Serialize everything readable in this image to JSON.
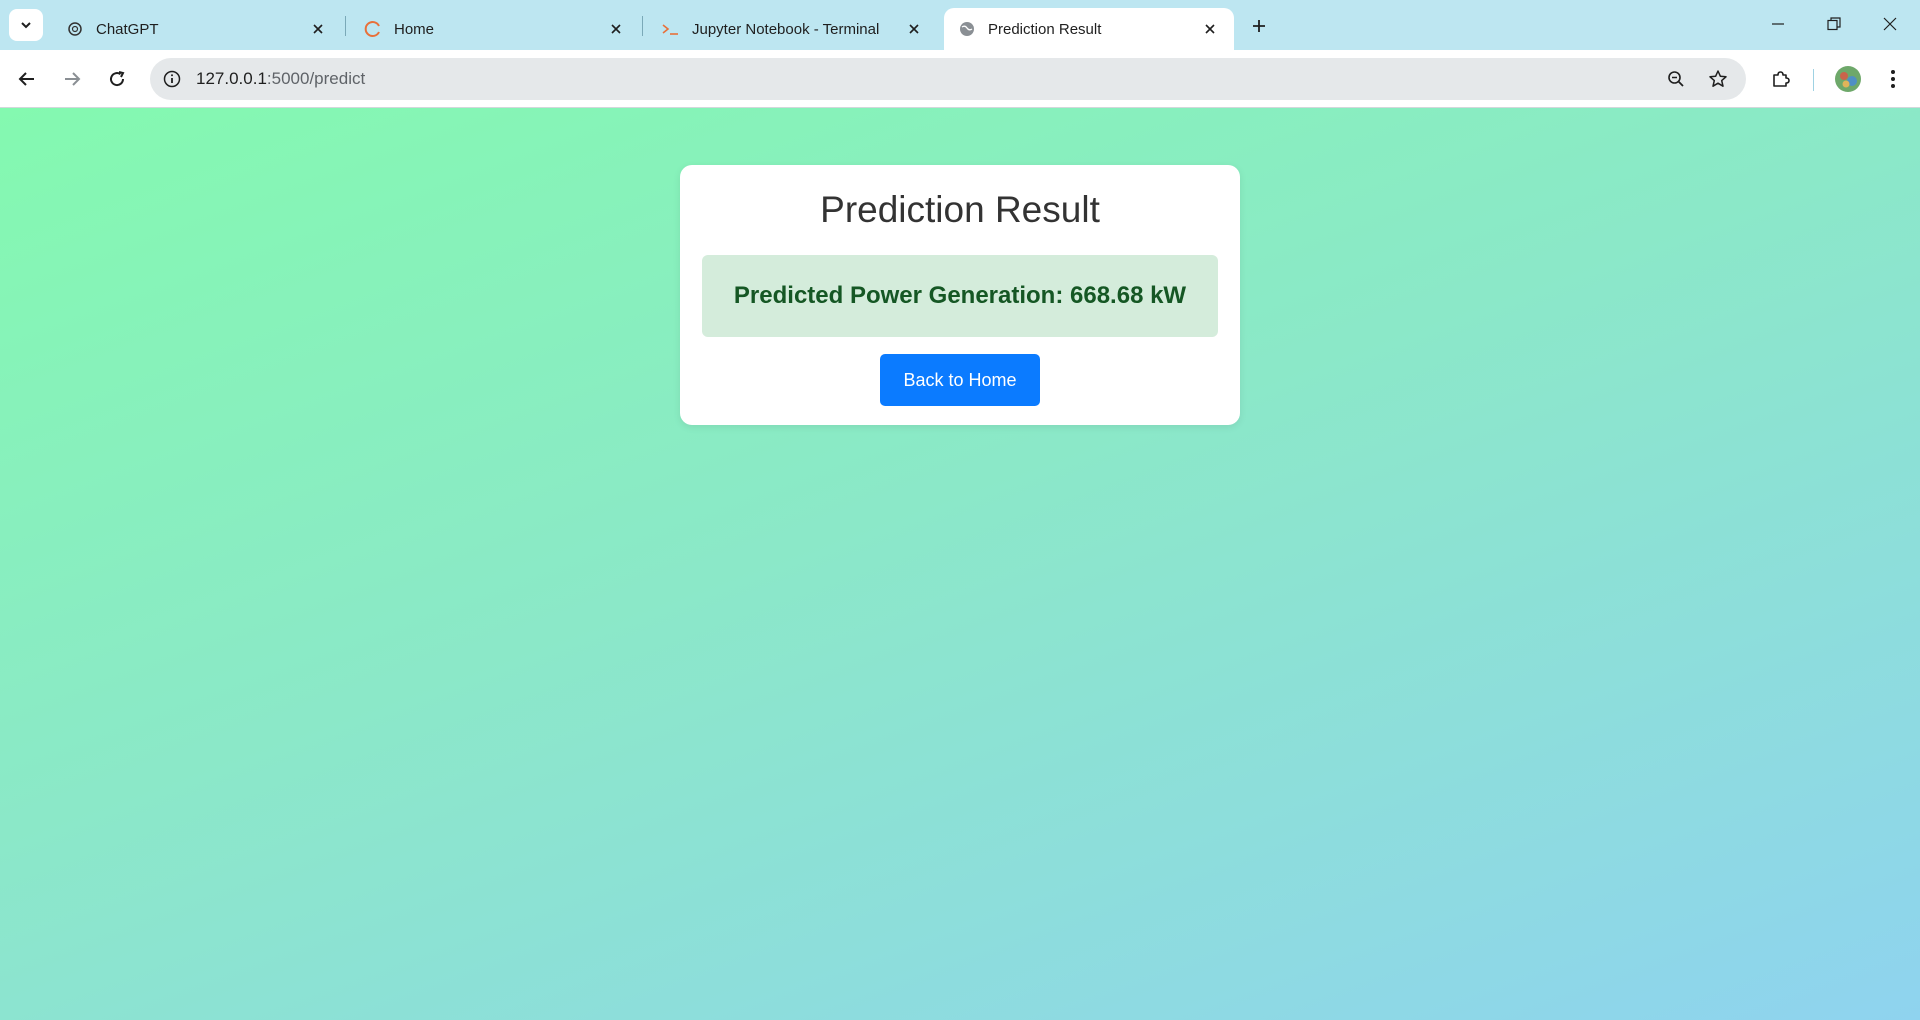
{
  "browser": {
    "tabs": [
      {
        "title": "ChatGPT",
        "icon": "chatgpt-icon",
        "active": false
      },
      {
        "title": "Home",
        "icon": "loading-spinner-icon",
        "active": false
      },
      {
        "title": "Jupyter Notebook - Terminal",
        "icon": "terminal-icon",
        "active": false
      },
      {
        "title": "Prediction Result",
        "icon": "globe-icon",
        "active": true
      }
    ],
    "address_bar": {
      "host": "127.0.0.1",
      "path": ":5000/predict"
    }
  },
  "page": {
    "heading": "Prediction Result",
    "result_text": "Predicted Power Generation: 668.68 kW",
    "back_button_label": "Back to Home"
  },
  "colors": {
    "tabstrip_bg": "#bde6f1",
    "button_blue": "#0b7bff",
    "result_bg": "#d4ecdb",
    "result_text": "#155724",
    "gradient_start": "#84f9b0",
    "gradient_end": "#8fd3ef"
  }
}
